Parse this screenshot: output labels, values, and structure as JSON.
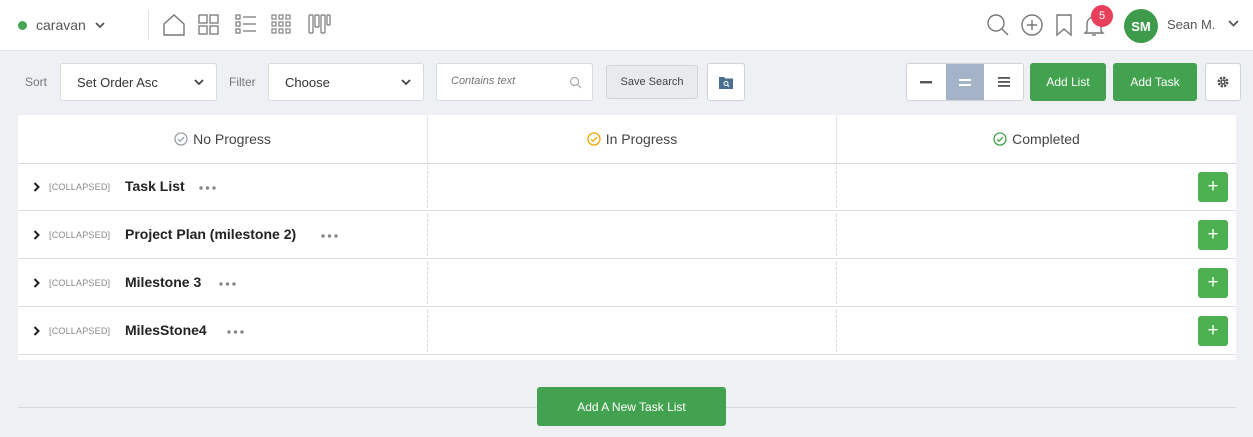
{
  "nav": {
    "project_name": "caravan",
    "notification_count": "5",
    "user_initials": "SM",
    "user_name": "Sean M."
  },
  "toolbar": {
    "sort_label": "Sort",
    "sort_value": "Set Order Asc",
    "filter_label": "Filter",
    "filter_value": "Choose",
    "search_placeholder": "Contains text",
    "save_search_label": "Save Search",
    "add_list_label": "Add List",
    "add_task_label": "Add Task"
  },
  "board": {
    "columns": [
      {
        "label": "No Progress",
        "icon": "check-circle-icon",
        "color": "#9aa0a6"
      },
      {
        "label": "In Progress",
        "icon": "check-circle-icon",
        "color": "#f0a500"
      },
      {
        "label": "Completed",
        "icon": "check-circle-icon",
        "color": "#43a24f"
      }
    ],
    "task_lists": [
      {
        "tag": "[COLLAPSED]",
        "title": "Task List"
      },
      {
        "tag": "[COLLAPSED]",
        "title": "Project Plan (milestone 2)"
      },
      {
        "tag": "[COLLAPSED]",
        "title": "Milestone 3"
      },
      {
        "tag": "[COLLAPSED]",
        "title": "MilesStone4"
      }
    ],
    "add_task_list_label": "Add A New Task List"
  },
  "colors": {
    "accent_green": "#43a24f",
    "badge_red": "#e8405a",
    "active_view": "#a4b3c8"
  }
}
